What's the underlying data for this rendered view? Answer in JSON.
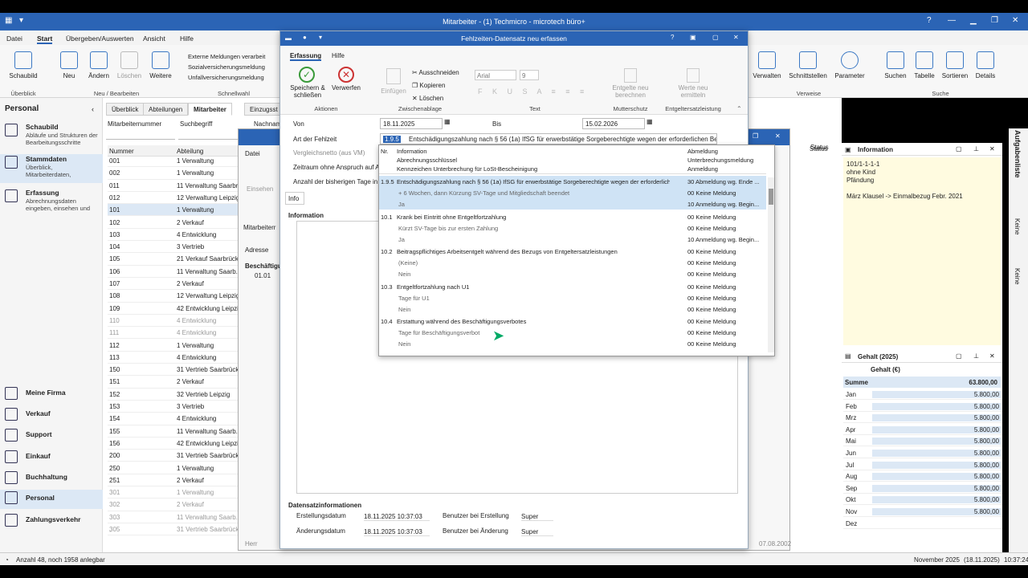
{
  "app": {
    "title": "Mitarbeiter - (1) Techmicro - microtech büro+"
  },
  "menu": {
    "datei": "Datei",
    "start": "Start",
    "uebergeben": "Übergeben/Auswerten",
    "ansicht": "Ansicht",
    "hilfe": "Hilfe"
  },
  "ribbon": {
    "schaubild": "Schaubild",
    "neu": "Neu",
    "aendern": "Ändern",
    "loeschen": "Löschen",
    "weitere": "Weitere",
    "g_ueberblick": "Überblick",
    "g_neu": "Neu / Bearbeiten",
    "ext1": "Externe Meldungen verarbeit",
    "ext2": "Sozialversicherungsmeldung",
    "ext3": "Unfallversicherungsmeldung",
    "g_schnellwahl": "Schnellwahl",
    "verwalten": "Verwalten",
    "schnittstellen": "Schnittstellen",
    "parameter": "Parameter",
    "g_verweise": "Verweise",
    "suchen": "Suchen",
    "tabelle": "Tabelle",
    "sortieren": "Sortieren",
    "details": "Details",
    "g_suche": "Suche"
  },
  "nav": {
    "title": "Personal",
    "schaubild": "Schaubild",
    "schaubild_d": "Abläufe und Strukturen der Bearbeitungsschritte",
    "stamm": "Stammdaten",
    "stamm_d": "Überblick, Mitarbeiterdaten,",
    "erf": "Erfassung",
    "erf_d": "Abrechnungsdaten eingeben, einsehen und",
    "firma": "Meine Firma",
    "verkauf": "Verkauf",
    "support": "Support",
    "einkauf": "Einkauf",
    "buch": "Buchhaltung",
    "personal": "Personal",
    "zahl": "Zahlungsverkehr"
  },
  "tabs": {
    "t1": "Überblick",
    "t2": "Abteilungen",
    "t3": "Mitarbeiter",
    "t4": "Einzugsst"
  },
  "filter": {
    "nr": "Mitarbeiternummer",
    "such": "Suchbegriff",
    "nach": "Nachnam"
  },
  "table": {
    "h1": "Nummer",
    "h2": "Abteilung",
    "status": "Status",
    "rows": [
      [
        "001",
        "1 Verwaltung"
      ],
      [
        "002",
        "1 Verwaltung"
      ],
      [
        "011",
        "11 Verwaltung Saarbr."
      ],
      [
        "012",
        "12 Verwaltung Leipzig"
      ],
      [
        "101",
        "1 Verwaltung"
      ],
      [
        "102",
        "2 Verkauf"
      ],
      [
        "103",
        "4 Entwicklung"
      ],
      [
        "104",
        "3 Vertrieb"
      ],
      [
        "105",
        "21 Verkauf Saarbrück"
      ],
      [
        "106",
        "11 Verwaltung Saarb."
      ],
      [
        "107",
        "2 Verkauf"
      ],
      [
        "108",
        "12 Verwaltung Leipzig"
      ],
      [
        "109",
        "42 Entwicklung Leipzi"
      ],
      [
        "110",
        "4 Entwicklung"
      ],
      [
        "111",
        "4 Entwicklung"
      ],
      [
        "112",
        "1 Verwaltung"
      ],
      [
        "113",
        "4 Entwicklung"
      ],
      [
        "150",
        "31 Vertrieb Saarbrück"
      ],
      [
        "151",
        "2 Verkauf"
      ],
      [
        "152",
        "32 Vertrieb Leipzig"
      ],
      [
        "153",
        "3 Vertrieb"
      ],
      [
        "154",
        "4 Entwicklung"
      ],
      [
        "155",
        "11 Verwaltung Saarb."
      ],
      [
        "156",
        "42 Entwicklung Leipzi"
      ],
      [
        "200",
        "31 Vertrieb Saarbrück"
      ],
      [
        "250",
        "1 Verwaltung"
      ],
      [
        "251",
        "2 Verkauf"
      ],
      [
        "301",
        "1 Verwaltung"
      ],
      [
        "302",
        "2 Verkauf"
      ],
      [
        "303",
        "11 Verwaltung Saarb."
      ],
      [
        "305",
        "31 Vertrieb Saarbrück"
      ]
    ]
  },
  "info": {
    "title": "Information",
    "l1": "101/1-1-1-1",
    "l2": "ohne Kind",
    "l3": "Pfändung",
    "l4": "März Klausel -> Einmalbezug Febr. 2021"
  },
  "gehalt": {
    "title": "Gehalt (2025)",
    "col": "Gehalt (€)",
    "summe": "Summe",
    "summe_v": "63.800,00",
    "months": [
      [
        "Jan",
        "5.800,00"
      ],
      [
        "Feb",
        "5.800,00"
      ],
      [
        "Mrz",
        "5.800,00"
      ],
      [
        "Apr",
        "5.800,00"
      ],
      [
        "Mai",
        "5.800,00"
      ],
      [
        "Jun",
        "5.800,00"
      ],
      [
        "Jul",
        "5.800,00"
      ],
      [
        "Aug",
        "5.800,00"
      ],
      [
        "Sep",
        "5.800,00"
      ],
      [
        "Okt",
        "5.800,00"
      ],
      [
        "Nov",
        "5.800,00"
      ],
      [
        "Dez",
        ""
      ]
    ]
  },
  "vtabs": {
    "a": "Aufgabenliste",
    "b": "Keine",
    "c": "Keine"
  },
  "status": {
    "left": "Anzahl 48, noch 1958 anlegbar",
    "month": "November 2025",
    "date": "(18.11.2025)",
    "time": "10:37:24"
  },
  "dialog": {
    "title": "Fehlzeiten-Datensatz neu erfassen",
    "tab1": "Erfassung",
    "tab2": "Hilfe",
    "speichern": "Speichern & schließen",
    "verwerfen": "Verwerfen",
    "g_aktionen": "Aktionen",
    "einfuegen": "Einfügen",
    "ausschneiden": "Ausschneiden",
    "kopieren": "Kopieren",
    "loeschen": "Löschen",
    "g_zwischen": "Zwischenablage",
    "font": "Arial",
    "size": "9",
    "g_text": "Text",
    "entgelte": "Entgelte neu berechnen",
    "g_mutter": "Mutterschutz",
    "werte": "Werte neu ermitteln",
    "g_entgelt": "Entgeltersatzleistung",
    "von": "Von",
    "von_v": "18.11.2025",
    "bis": "Bis",
    "bis_v": "15.02.2026",
    "art": "Art der Fehlzeit",
    "art_nr": "1.9.5",
    "art_v": "Entschädigungszahlung nach § 56 (1a) IfSG für erwerbstätige  Sorgeberechtigte wegen der erforderlichen Be",
    "vgl": "Vergleichsnetto (aus VM)",
    "zeitraum": "Zeitraum ohne Anspruch auf A",
    "anzahl": "Anzahl der bisherigen Tage in",
    "info_tab": "Info",
    "info_label": "Information",
    "meta": "Datensatzinformationen",
    "erst": "Erstellungsdatum",
    "erst_v": "18.11.2025 10:37:03",
    "benerst": "Benutzer bei Erstellung",
    "benerst_v": "Super",
    "aend": "Änderungsdatum",
    "aend_v": "18.11.2025 10:37:03",
    "benaend": "Benutzer bei Änderung",
    "benaend_v": "Super"
  },
  "bgdlg": {
    "datei": "Datei",
    "einsehen": "Einsehen",
    "mitarb": "Mitarbeiterr",
    "adresse": "Adresse",
    "besch": "Beschäftigu",
    "d1": "01.01",
    "date2": "07.08.2002",
    "status": "Status",
    "herr": "Herr"
  },
  "dropdown": {
    "h_nr": "Nr.",
    "h_a1": "Information",
    "h_a2": "Abrechnungsschlüssel",
    "h_a3": "Kennzeichen Unterbrechung für LoSt-Bescheinigung",
    "h_b1": "Abmeldung",
    "h_b2": "Unterbrechungsmeldung",
    "h_b3": "Anmeldung",
    "items": [
      {
        "nr": "1.9.5",
        "a": "Entschädigungszahlung nach § 56 (1a) IfSG für erwerbstätige  Sorgeberechtigte wegen der erforderlichen",
        "b": "30  Abmeldung wg. Ende ..."
      },
      {
        "nr": "",
        "a": "+ 6 Wochen, dann Kürzung SV-Tage und Mitgliedschaft beendet",
        "b": "00  Keine Meldung"
      },
      {
        "nr": "",
        "a": "Ja",
        "b": "10  Anmeldung wg. Begin..."
      },
      {
        "nr": "10.1",
        "a": "Krank bei Eintritt ohne Entgeltfortzahlung",
        "b": "00  Keine Meldung"
      },
      {
        "nr": "",
        "a": "Kürzt SV-Tage bis zur ersten Zahlung",
        "b": "00  Keine Meldung"
      },
      {
        "nr": "",
        "a": "Ja",
        "b": "10  Anmeldung wg. Begin..."
      },
      {
        "nr": "10.2",
        "a": "Beitragspflichtiges Arbeitsentgelt während des Bezugs von Entgeltersatzleistungen",
        "b": "00  Keine Meldung"
      },
      {
        "nr": "",
        "a": "(Keine)",
        "b": "00  Keine Meldung"
      },
      {
        "nr": "",
        "a": "Nein",
        "b": "00  Keine Meldung"
      },
      {
        "nr": "10.3",
        "a": "Entgeltfortzahlung nach U1",
        "b": "00  Keine Meldung"
      },
      {
        "nr": "",
        "a": "Tage für U1",
        "b": "00  Keine Meldung"
      },
      {
        "nr": "",
        "a": "Nein",
        "b": "00  Keine Meldung"
      },
      {
        "nr": "10.4",
        "a": "Erstattung während des Beschäftigungsverbotes",
        "b": "00  Keine Meldung"
      },
      {
        "nr": "",
        "a": "Tage für Beschäftigungsverbot",
        "b": "00  Keine Meldung"
      },
      {
        "nr": "",
        "a": "Nein",
        "b": "00  Keine Meldung"
      }
    ]
  }
}
